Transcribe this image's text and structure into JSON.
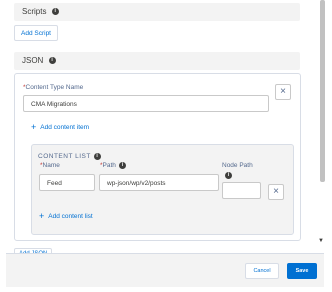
{
  "scripts": {
    "title": "Scripts",
    "add_label": "Add Script"
  },
  "json": {
    "title": "JSON",
    "content_type_label": "Content Type Name",
    "content_type_value": "CMA Migrations",
    "add_content_item_label": "Add content item",
    "content_list": {
      "title": "CONTENT LIST",
      "name_label": "Name",
      "path_label": "Path",
      "node_path_label": "Node Path",
      "name_value": "Feed",
      "path_value": "wp-json/wp/v2/posts",
      "node_path_value": "",
      "add_content_list_label": "Add content list"
    },
    "add_json_partial": "Add JSON"
  },
  "footer": {
    "cancel_label": "Cancel",
    "save_label": "Save"
  }
}
